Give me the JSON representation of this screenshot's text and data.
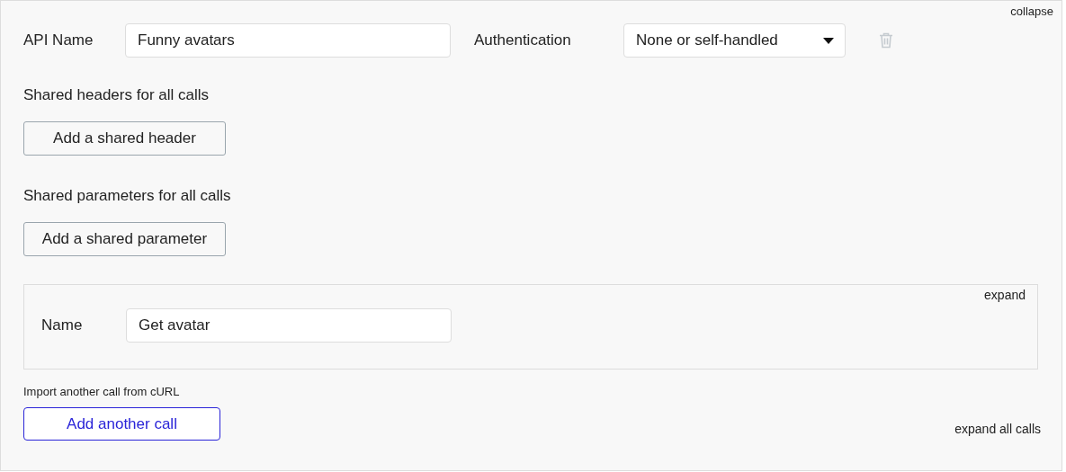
{
  "collapse_link": "collapse",
  "api_name": {
    "label": "API Name",
    "value": "Funny avatars"
  },
  "authentication": {
    "label": "Authentication",
    "value": "None or self-handled"
  },
  "shared_headers": {
    "heading": "Shared headers for all calls",
    "button": "Add a shared header"
  },
  "shared_parameters": {
    "heading": "Shared parameters for all calls",
    "button": "Add a shared parameter"
  },
  "calls": [
    {
      "expand_link": "expand",
      "name_label": "Name",
      "name_value": "Get avatar"
    }
  ],
  "import_link": "Import another call from cURL",
  "add_call_button": "Add another call",
  "expand_all_link": "expand all calls"
}
